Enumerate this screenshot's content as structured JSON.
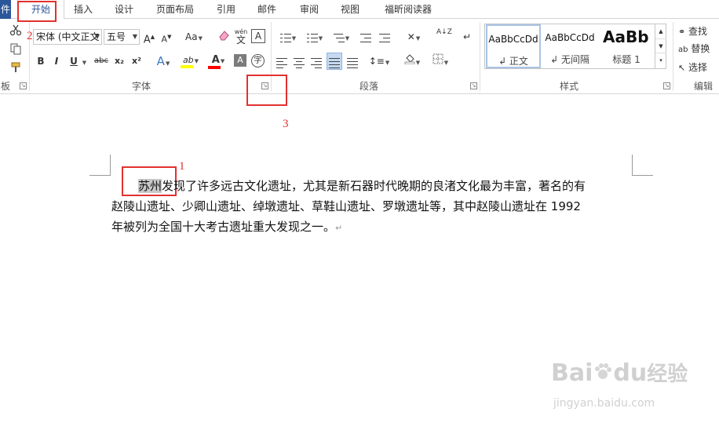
{
  "tabs": {
    "file": "件",
    "home": "开始",
    "insert": "插入",
    "design": "设计",
    "layout": "页面布局",
    "references": "引用",
    "mailings": "邮件",
    "review": "审阅",
    "view": "视图",
    "foxit": "福昕阅读器"
  },
  "clipboard": {
    "label": "板"
  },
  "font": {
    "family": "宋体 (中文正文",
    "size": "五号",
    "grow": "A",
    "shrink": "A",
    "case": "Aa",
    "wen": "wén",
    "wen_char": "文",
    "box_a": "A",
    "bold": "B",
    "italic": "I",
    "underline": "U",
    "strike": "abc",
    "subscript": "x₂",
    "superscript": "x²",
    "effects": "A",
    "highlight": "ab",
    "color": "A",
    "shading": "A",
    "enclose": "字",
    "label": "字体"
  },
  "paragraph": {
    "label": "段落",
    "sort": "A↓Z"
  },
  "styles": {
    "label": "样式",
    "items": [
      {
        "sample": "AaBbCcDd",
        "name": "↲ 正文"
      },
      {
        "sample": "AaBbCcDd",
        "name": "↲ 无间隔"
      },
      {
        "sample": "AaBb",
        "name": "标题 1"
      }
    ]
  },
  "editing": {
    "label": "编辑",
    "find": "查找",
    "replace": "替换",
    "select": "选择"
  },
  "annotations": {
    "one": "1",
    "two": "2",
    "three": "3"
  },
  "document": {
    "highlight": "苏州",
    "line1_rest": "发现了许多远古文化遗址，尤其是新石器时代晚期的良渚文化最为丰富，著名的有",
    "line2": "赵陵山遗址、少卿山遗址、绰墩遗址、草鞋山遗址、罗墩遗址等，其中赵陵山遗址在 1992",
    "line3": "年被列为全国十大考古遗址重大发现之一。",
    "pilcrow": "↵"
  },
  "watermark": {
    "brand_a": "Bai",
    "brand_b": "du",
    "brand_c": "经验",
    "url": "jingyan.baidu.com"
  },
  "colors": {
    "accent": "#2b579a",
    "annotation": "#e0322f",
    "highlight": "#c8c8c8",
    "text_highlight_yellow": "#ffff00",
    "font_color_red": "#ff0000"
  }
}
